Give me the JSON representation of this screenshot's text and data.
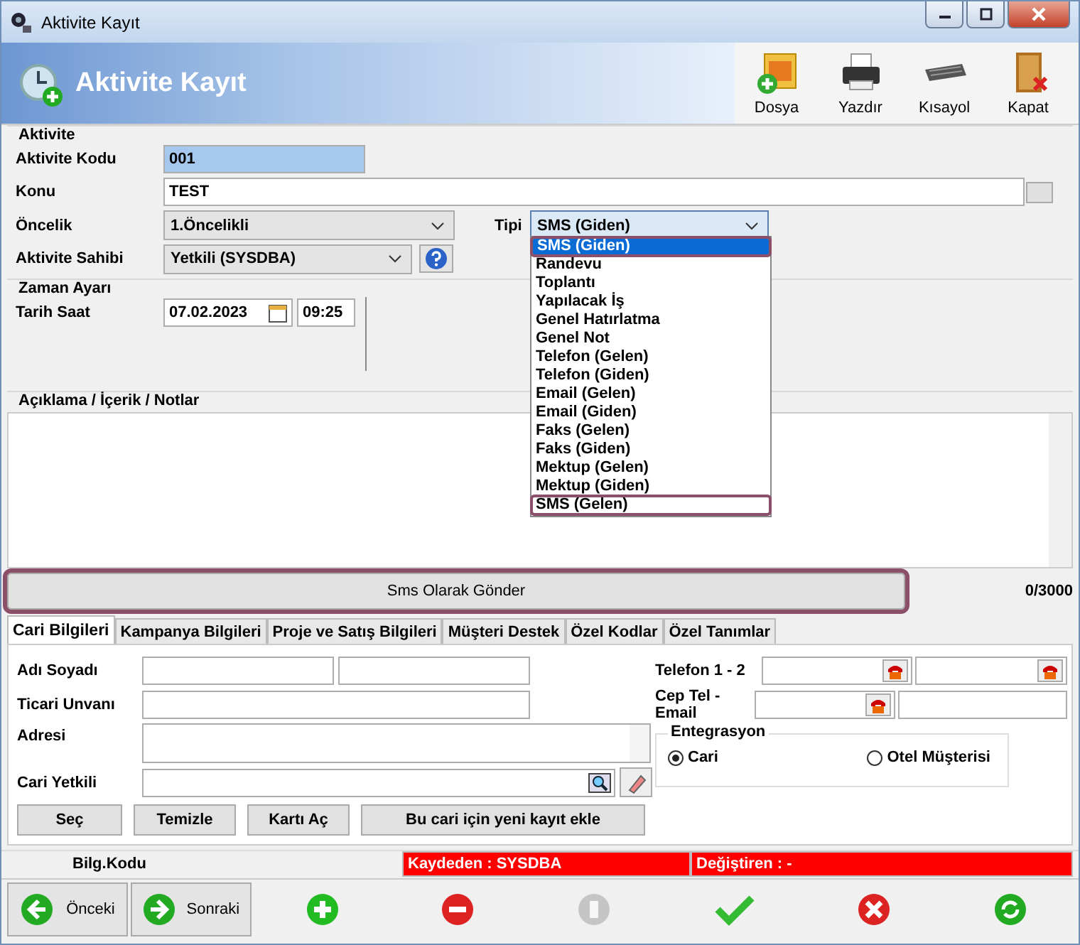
{
  "window": {
    "title": "Aktivite Kayıt"
  },
  "header": {
    "title": "Aktivite Kayıt",
    "tools": [
      {
        "label": "Dosya",
        "kind": "file"
      },
      {
        "label": "Yazdır",
        "kind": "print"
      },
      {
        "label": "Kısayol",
        "kind": "keyboard"
      },
      {
        "label": "Kapat",
        "kind": "exit"
      }
    ]
  },
  "aktivite": {
    "legend": "Aktivite",
    "code": {
      "label": "Aktivite Kodu",
      "value": "001"
    },
    "subject": {
      "label": "Konu",
      "value": "TEST"
    },
    "priority": {
      "label": "Öncelik",
      "value": "1.Öncelikli"
    },
    "type": {
      "label": "Tipi",
      "value": "SMS (Giden)",
      "options": [
        {
          "label": "SMS (Giden)",
          "selected": true,
          "highlighted": true
        },
        {
          "label": "Randevu",
          "selected": false,
          "highlighted": false
        },
        {
          "label": "Toplantı",
          "selected": false,
          "highlighted": false
        },
        {
          "label": "Yapılacak İş",
          "selected": false,
          "highlighted": false
        },
        {
          "label": "Genel Hatırlatma",
          "selected": false,
          "highlighted": false
        },
        {
          "label": "Genel Not",
          "selected": false,
          "highlighted": false
        },
        {
          "label": "Telefon (Gelen)",
          "selected": false,
          "highlighted": false
        },
        {
          "label": "Telefon (Giden)",
          "selected": false,
          "highlighted": false
        },
        {
          "label": "Email (Gelen)",
          "selected": false,
          "highlighted": false
        },
        {
          "label": "Email (Giden)",
          "selected": false,
          "highlighted": false
        },
        {
          "label": "Faks (Gelen)",
          "selected": false,
          "highlighted": false
        },
        {
          "label": "Faks (Giden)",
          "selected": false,
          "highlighted": false
        },
        {
          "label": "Mektup (Gelen)",
          "selected": false,
          "highlighted": false
        },
        {
          "label": "Mektup (Giden)",
          "selected": false,
          "highlighted": false
        },
        {
          "label": "SMS (Gelen)",
          "selected": false,
          "highlighted": true
        }
      ]
    },
    "owner": {
      "label": "Aktivite Sahibi",
      "value": "Yetkili  (SYSDBA)"
    }
  },
  "time": {
    "legend": "Zaman Ayarı",
    "label": "Tarih Saat",
    "date": "07.02.2023",
    "hour": "09:25"
  },
  "notes": {
    "legend": "Açıklama / İçerik / Notlar"
  },
  "sms": {
    "button": "Sms Olarak Gönder",
    "highlighted": true,
    "counter": "0/3000"
  },
  "tabs": [
    {
      "label": "Cari Bilgileri",
      "selected": true
    },
    {
      "label": "Kampanya Bilgileri",
      "selected": false
    },
    {
      "label": "Proje ve Satış Bilgileri",
      "selected": false
    },
    {
      "label": "Müşteri Destek",
      "selected": false
    },
    {
      "label": "Özel Kodlar",
      "selected": false
    },
    {
      "label": "Özel Tanımlar",
      "selected": false
    }
  ],
  "cari": {
    "name": "Adı Soyadı",
    "title": "Ticari Unvanı",
    "address": "Adresi",
    "contact": "Cari Yetkili",
    "phone": "Telefon 1 - 2",
    "mobile": "Cep Tel - Email",
    "integration": {
      "legend": "Entegrasyon",
      "options": [
        {
          "label": "Cari",
          "selected": true
        },
        {
          "label": "Otel Müşterisi",
          "selected": false
        }
      ]
    },
    "buttons": [
      "Seç",
      "Temizle",
      "Kartı Aç",
      "Bu cari için yeni kayıt ekle"
    ]
  },
  "status": {
    "code": "Bilg.Kodu",
    "created": "Kaydeden : SYSDBA",
    "modified": "Değiştiren :  -"
  },
  "nav": {
    "prev": "Önceki",
    "next": "Sonraki",
    "actions": [
      {
        "kind": "add",
        "disabled": false
      },
      {
        "kind": "delete",
        "disabled": false
      },
      {
        "kind": "edit",
        "disabled": true
      },
      {
        "kind": "save",
        "disabled": false
      },
      {
        "kind": "cancel",
        "disabled": false
      },
      {
        "kind": "refresh",
        "disabled": false
      }
    ]
  }
}
